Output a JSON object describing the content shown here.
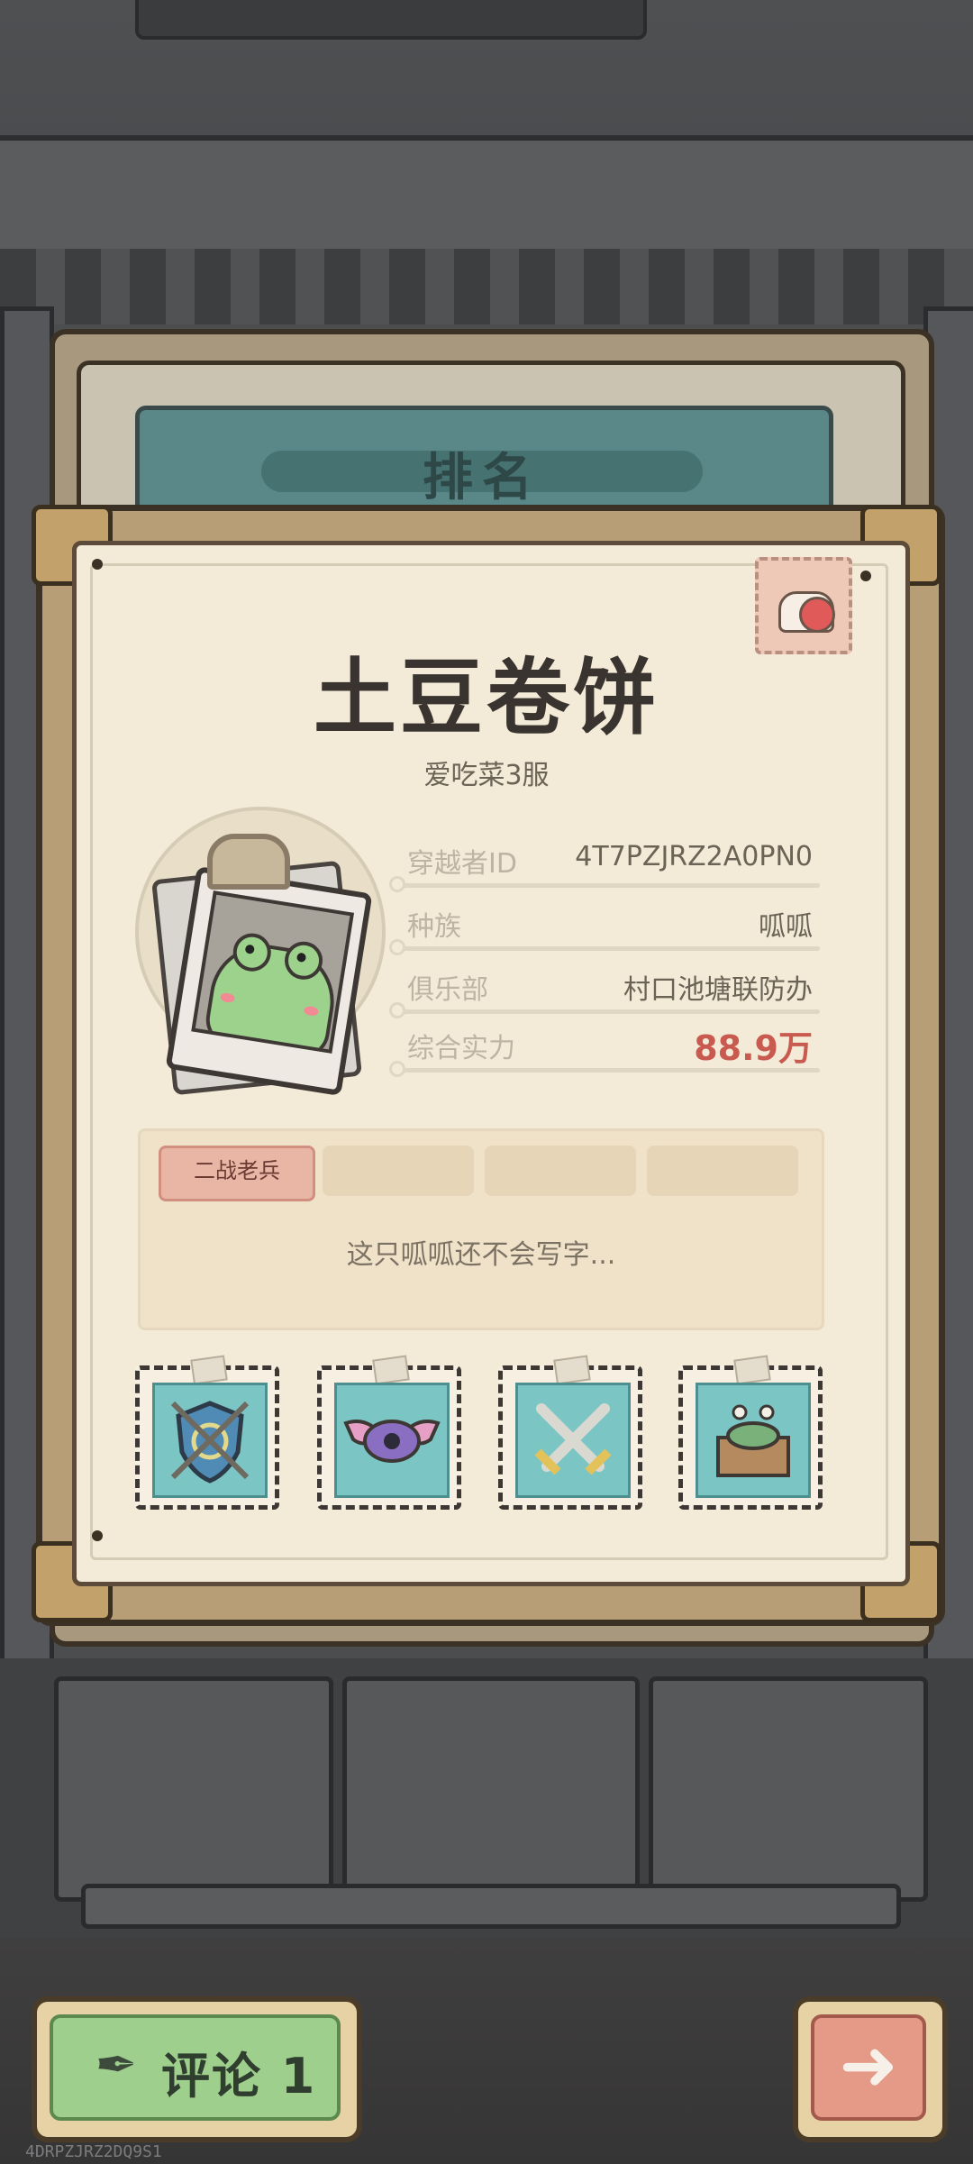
{
  "screen": {
    "title": "排名"
  },
  "profile": {
    "nickname": "土豆卷饼",
    "server": "爱吃菜3服",
    "stats": [
      {
        "label": "穿越者ID",
        "value": "4T7PZJRZ2A0PN0"
      },
      {
        "label": "种族",
        "value": "呱呱"
      },
      {
        "label": "俱乐部",
        "value": "村口池塘联防办"
      },
      {
        "label": "综合实力",
        "value": "88.9万"
      }
    ],
    "tags": [
      "二战老兵",
      "",
      "",
      ""
    ],
    "description": "这只呱呱还不会写字..."
  },
  "badges": [
    {
      "icon": "shield-badge-icon"
    },
    {
      "icon": "winged-eye-badge-icon"
    },
    {
      "icon": "crossed-swords-badge-icon"
    },
    {
      "icon": "snail-box-badge-icon"
    }
  ],
  "footer": {
    "comment_label": "评论 1",
    "next_icon": "arrow-right-icon",
    "uid": "4DRPZJRZ2DQ9S1"
  },
  "colors": {
    "paper": "#f3ebd7",
    "power": "#c85a4f",
    "teal_plate": "#5a8787",
    "comment_green": "#9fcf8c",
    "next_red": "#e49a86"
  }
}
